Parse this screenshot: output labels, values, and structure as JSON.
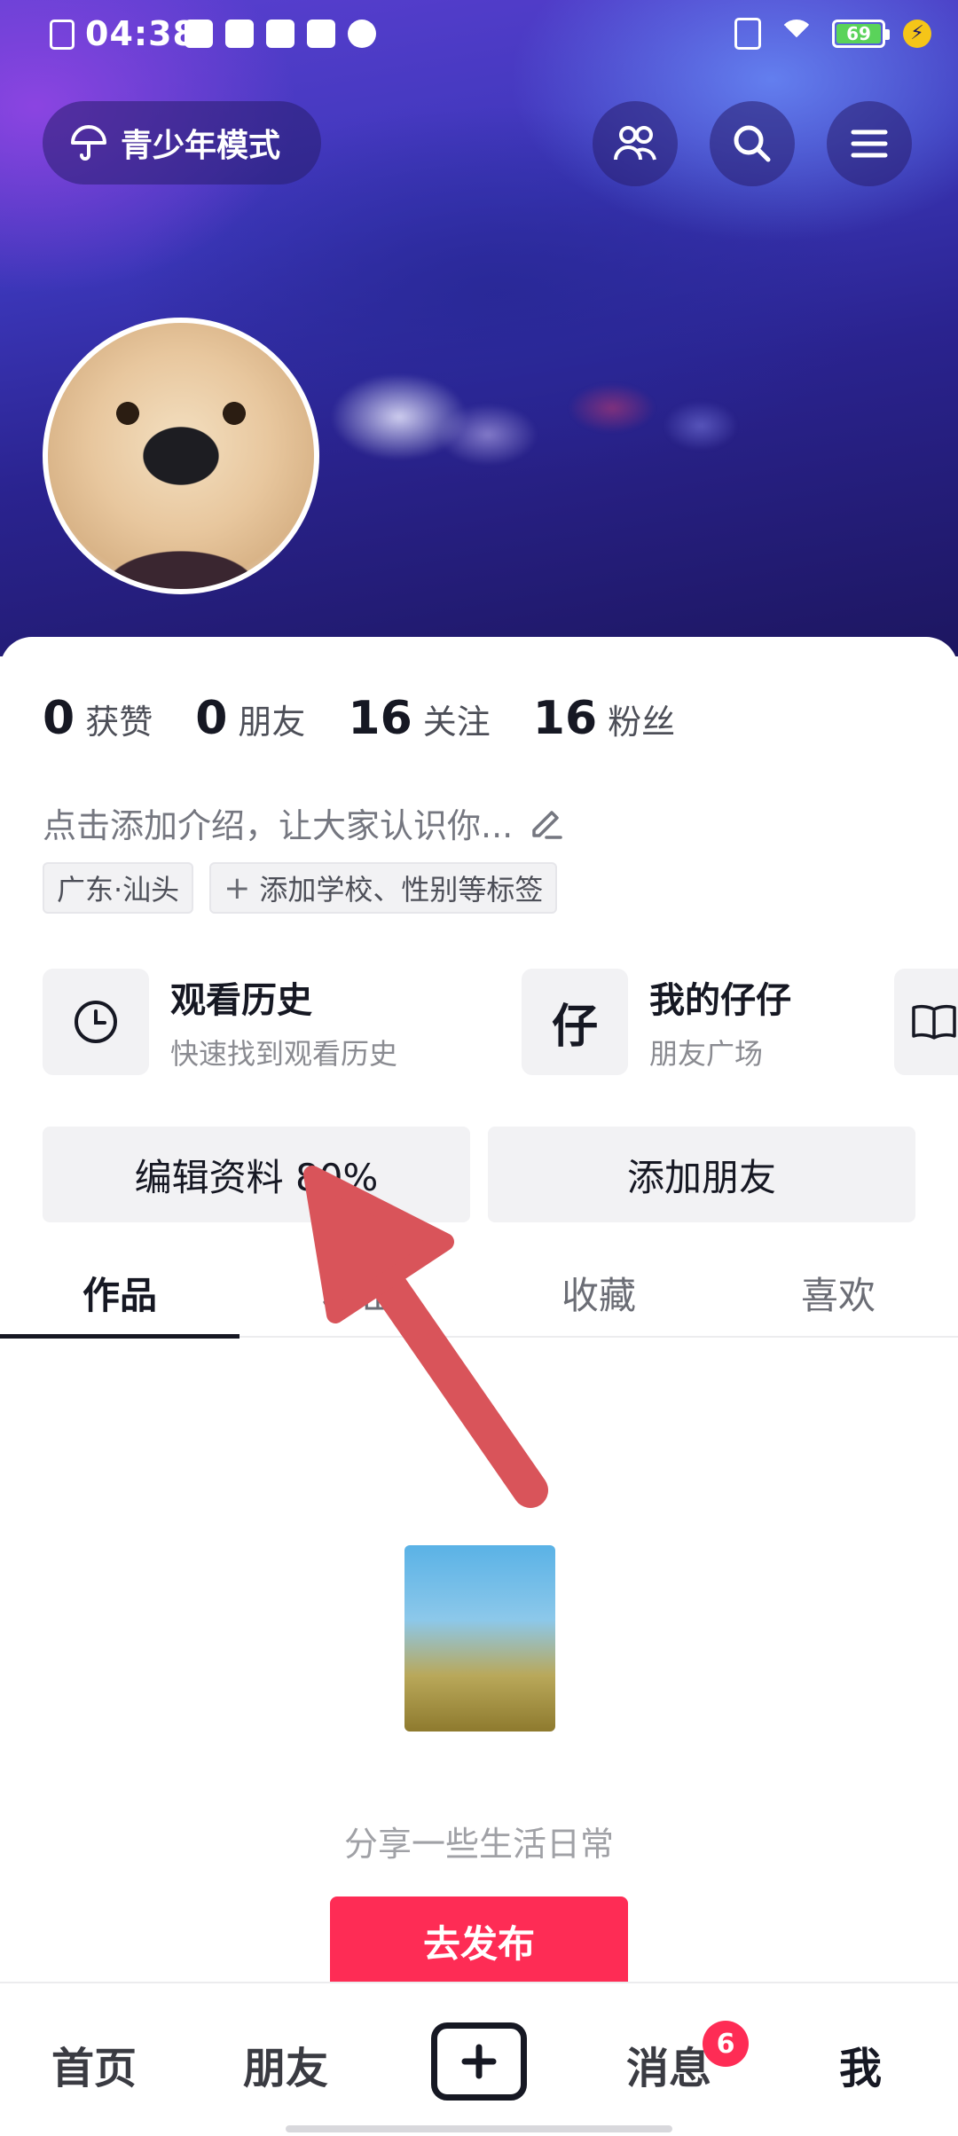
{
  "status_bar": {
    "time": "04:38",
    "battery": "69"
  },
  "header": {
    "teen_mode_label": "青少年模式"
  },
  "stats": [
    {
      "num": "0",
      "label": "获赞"
    },
    {
      "num": "0",
      "label": "朋友"
    },
    {
      "num": "16",
      "label": "关注"
    },
    {
      "num": "16",
      "label": "粉丝"
    }
  ],
  "bio": {
    "placeholder": "点击添加介绍，让大家认识你..."
  },
  "tags": {
    "location": "广东·汕头",
    "add_tag": "添加学校、性别等标签"
  },
  "shortcuts": [
    {
      "title": "观看历史",
      "sub": "快速找到观看历史",
      "icon": "clock-icon"
    },
    {
      "title": "我的仔仔",
      "sub": "朋友广场",
      "icon": "zaizai-icon"
    },
    {
      "title": "",
      "sub": "",
      "icon": "book-icon"
    }
  ],
  "actions": {
    "edit_profile": "编辑资料 80%",
    "add_friend": "添加朋友"
  },
  "tabs": [
    "作品",
    "私密",
    "收藏",
    "喜欢"
  ],
  "empty": {
    "subtitle": "分享一些生活日常",
    "publish": "去发布"
  },
  "bottom_nav": {
    "home": "首页",
    "friends": "朋友",
    "messages": "消息",
    "messages_badge": "6",
    "me": "我"
  },
  "colors": {
    "accent": "#fe2c55",
    "arrow": "#d9545a"
  }
}
